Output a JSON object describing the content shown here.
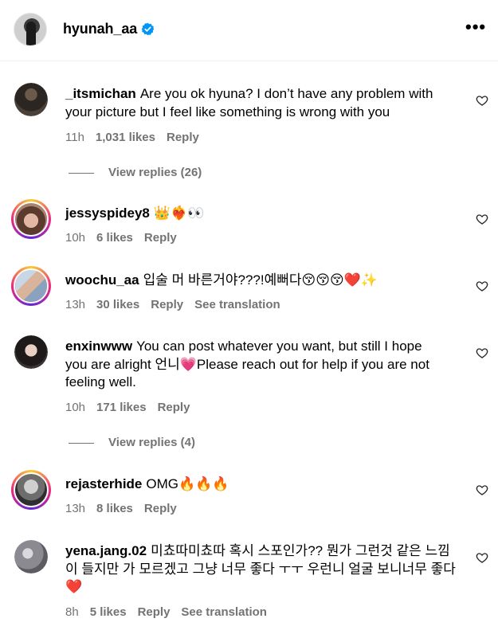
{
  "header": {
    "username": "hyunah_aa",
    "verified_icon": "verified-badge-icon",
    "more_label": "•••"
  },
  "colors": {
    "meta": "#737373",
    "verified": "#0095f6",
    "divider": "#efefef"
  },
  "comments": [
    {
      "user": "_itsmichan",
      "text_lines": [
        "Are you ok hyuna? I don’t have any problem with",
        "your picture but I feel like something is wrong with you"
      ],
      "time": "11h",
      "likes": "1,031 likes",
      "reply": "Reply",
      "translation": "",
      "view_replies": "View replies (26)"
    },
    {
      "user": "jessyspidey8",
      "text_lines": [
        "👑❤️‍🔥👀"
      ],
      "time": "10h",
      "likes": "6 likes",
      "reply": "Reply",
      "translation": "",
      "view_replies": ""
    },
    {
      "user": "woochu_aa",
      "text_lines": [
        "입술 머 바른거야???!예뻐다😚😚😚❤️✨"
      ],
      "time": "13h",
      "likes": "30 likes",
      "reply": "Reply",
      "translation": "See translation",
      "view_replies": ""
    },
    {
      "user": "enxinwww",
      "text_lines": [
        "You can post whatever you want, but still I hope",
        "you are alright 언니💗Please reach out for help if you are not",
        "feeling well."
      ],
      "time": "10h",
      "likes": "171 likes",
      "reply": "Reply",
      "translation": "",
      "view_replies": "View replies (4)"
    },
    {
      "user": "rejasterhide",
      "text_lines": [
        "OMG🔥🔥🔥"
      ],
      "time": "13h",
      "likes": "8 likes",
      "reply": "Reply",
      "translation": "",
      "view_replies": ""
    },
    {
      "user": "yena.jang.02",
      "text_lines": [
        "미쵸따미쵸따 혹시 스포인가?? 뭔가 그런것 같은 느낌",
        "이 들지만 가 모르겠고 그냥 너무 좋다 ㅜㅜ 우런니 얼굴 보니너무 좋다",
        "❤️"
      ],
      "time": "8h",
      "likes": "5 likes",
      "reply": "Reply",
      "translation": "See translation",
      "view_replies": ""
    }
  ]
}
